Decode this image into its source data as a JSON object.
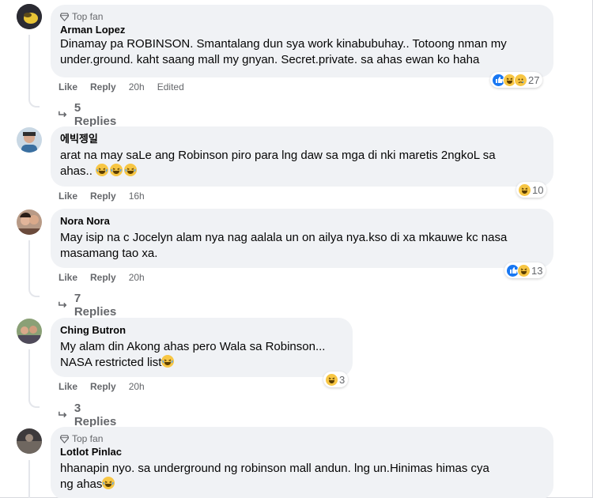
{
  "comments": [
    {
      "badge": "Top fan",
      "name": "Arman Lopez",
      "text_lines": [
        "Dinamay pa ROBINSON. Smantalang dun sya work kinabubuhay.. Totoong nman my",
        "under.ground. kaht saang mall my gnyan. Secret.private. sa ahas ewan ko haha"
      ],
      "like": "Like",
      "reply": "Reply",
      "time": "20h",
      "edited": "Edited",
      "reaction_icons": [
        "like-icon",
        "haha-icon",
        "sad-icon"
      ],
      "reaction_count": "27",
      "replies_label": "5 Replies"
    },
    {
      "name": "에빅젱일",
      "text_lines": [
        "arat na may saLe ang Robinson piro para lng daw sa mga di nki maretis 2ngkoL sa",
        "ahas.."
      ],
      "like": "Like",
      "reply": "Reply",
      "time": "16h",
      "reaction_icons": [
        "haha-icon"
      ],
      "reaction_count": "10"
    },
    {
      "name": "Nora Nora",
      "text_lines": [
        "May isip na c Jocelyn alam nya nag aalala un on ailya nya.kso di xa mkauwe kc nasa",
        "masamang tao xa."
      ],
      "like": "Like",
      "reply": "Reply",
      "time": "20h",
      "reaction_icons": [
        "like-icon",
        "haha-icon"
      ],
      "reaction_count": "13",
      "replies_label": "7 Replies"
    },
    {
      "name": "Ching Butron",
      "text_lines": [
        "My alam din Akong ahas pero Wala sa Robinson...",
        "NASA restricted list"
      ],
      "like": "Like",
      "reply": "Reply",
      "time": "20h",
      "reaction_icons": [
        "haha-icon"
      ],
      "reaction_count": "3",
      "replies_label": "3 Replies"
    },
    {
      "badge": "Top fan",
      "name": "Lotlot Pinlac",
      "text_lines": [
        "hhanapin nyo. sa underground ng robinson mall andun. lng un.Hinimas himas cya",
        "ng ahas"
      ]
    }
  ],
  "colors": {
    "bubble": "#f0f2f5",
    "secondary_text": "#65676b",
    "like_blue": "#1877f2",
    "emoji_yellow": "#f7c644"
  }
}
